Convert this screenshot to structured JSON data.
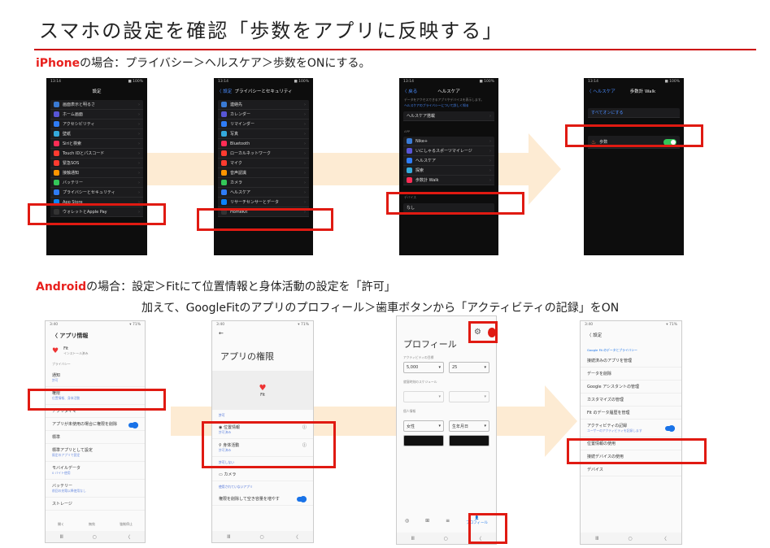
{
  "title": "スマホの設定を確認「歩数をアプリに反映する」",
  "iphone": {
    "keyword": "iPhone",
    "rest": "の場合：プライバシー＞ヘルスケア＞歩数をONにする。",
    "s1": {
      "status_time": "13:14",
      "status_batt": "■ 100%",
      "header": "設定",
      "rows": [
        "画面表示と明るさ",
        "ホーム画面",
        "アクセシビリティ",
        "壁紙",
        "Siriと検索",
        "Touch IDとパスコード",
        "緊急SOS",
        "接触通知",
        "バッテリー",
        "プライバシーとセキュリティ",
        "App Store",
        "ウォレットとApple Pay"
      ]
    },
    "s2": {
      "back": "〈 設定",
      "header": "プライバシーとセキュリティ",
      "rows": [
        "連絡先",
        "カレンダー",
        "リマインダー",
        "写真",
        "Bluetooth",
        "ローカルネットワーク",
        "マイク",
        "音声認識",
        "カメラ",
        "ヘルスケア",
        "リサーチセンサーとデータ",
        "HomeKit"
      ]
    },
    "s3": {
      "back": "〈 戻る",
      "header": "ヘルスケア",
      "desc": "データをアクセスできるアプリやデバイスを表示します。",
      "link": "ヘルスケアのプライバシーについて詳しく知る",
      "device": "ヘルスケア搭載",
      "apps_label": "APP",
      "rows": [
        "Nike+",
        "いにしゃるスポーツマイレージ",
        "ヘルスケア",
        "探索",
        "歩数計 Walk"
      ],
      "other_label": "デバイス",
      "other": "なし"
    },
    "s4": {
      "back": "〈 ヘルスケア",
      "header": "歩数計 Walk",
      "btn": "すべてオンにする",
      "row": "歩数"
    }
  },
  "android": {
    "keyword": "Android",
    "rest": "の場合：設定＞Fitにて位置情報と身体活動の設定を「許可」",
    "line2": "加えて、GoogleFitのアプリのプロフィール＞歯車ボタンから「アクティビティの記録」をON",
    "s1": {
      "status": "3:40",
      "status_r": "▾ 71%",
      "header": "〈 アプリ情報",
      "app": "Fit",
      "app_sub": "インストール済み",
      "sec": "プライバシー",
      "rows": [
        {
          "t": "通知",
          "s": "許可"
        },
        {
          "t": "権限",
          "s": "位置情報、身体活動"
        },
        {
          "t": "アプリタイマー",
          "s": ""
        },
        {
          "t": "アプリが未使用の場合に権限を削除",
          "s": ""
        },
        {
          "t": "標準",
          "s": ""
        },
        {
          "t": "標準アプリとして設定",
          "s": "既定のアプリで設定"
        },
        {
          "t": "モバイルデータ",
          "s": "0 バイト使用"
        },
        {
          "t": "バッテリー",
          "s": "前回の充電以降使用なし"
        },
        {
          "t": "ストレージ",
          "s": ""
        }
      ],
      "nav": [
        "開く",
        "無効",
        "強制停止"
      ]
    },
    "s2": {
      "header": "アプリの権限",
      "app": "Fit",
      "allowed": "許可",
      "rows": [
        "位置情報",
        "身体活動"
      ],
      "row_sub": "許可済み",
      "denied": "許可しない",
      "denied_row": "カメラ",
      "unused": "使用されていないアプリ",
      "remove": "権限を削除して空き容量を増やす"
    },
    "s3": {
      "header": "プロフィール",
      "sec1": "アクティビティの目標",
      "f1": "5,000",
      "f2": "25",
      "sec2": "就寝時刻のスケジュール",
      "sec3": "個人情報",
      "f3": "女性",
      "f4": "生年月日",
      "nav": "プロフィール"
    },
    "s4": {
      "header": "〈 設定",
      "sec": "Google Fit のデータとプライバシー",
      "rows": [
        "接続済みのアプリを管理",
        "データを削除",
        "Google アシスタントの管理",
        "カスタマイズの管理",
        "Fit のデータ履歴を管理",
        "アクティビティの記録",
        "位置情報の使用",
        "接続デバイスの使用",
        "デバイス"
      ],
      "rec_sub": "ユーザーのアクティビティを記録します"
    }
  }
}
